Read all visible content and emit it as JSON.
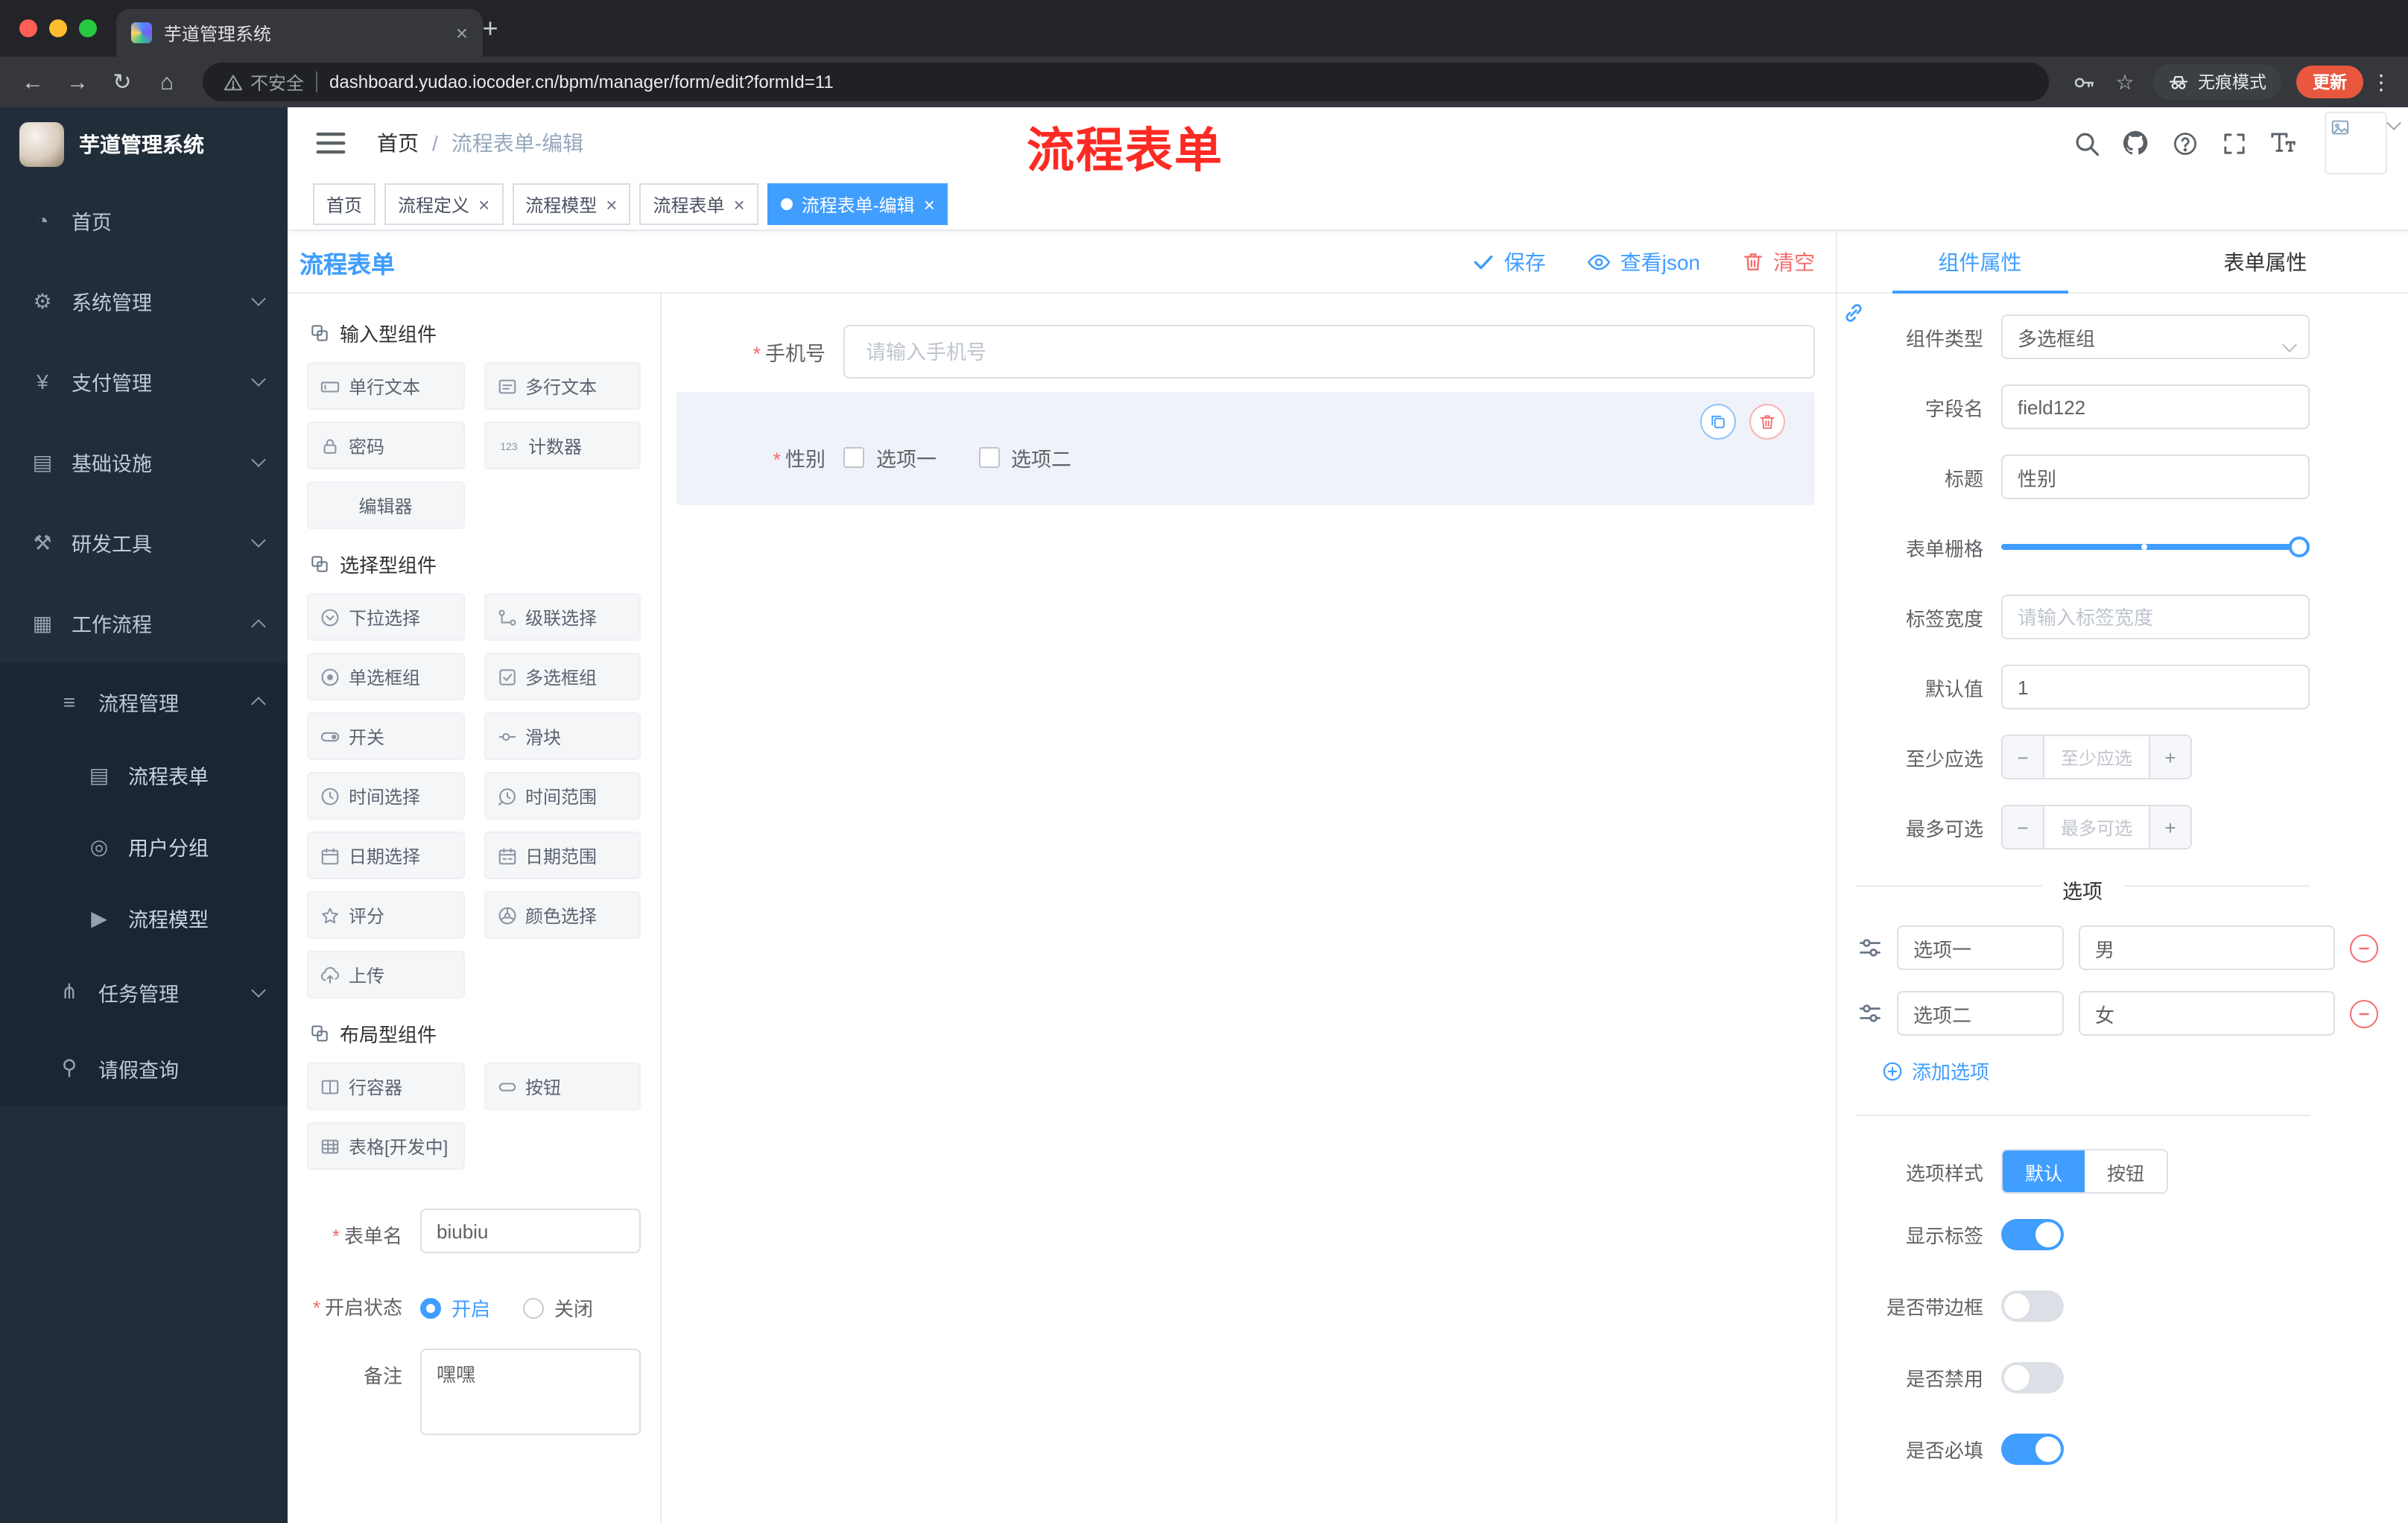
{
  "icons": {
    "close": "×",
    "plus": "+",
    "more": "⋮",
    "back": "←",
    "forward": "→",
    "reload": "↻",
    "home": "⌂",
    "bookmark": "☆",
    "required": "*",
    "minus": "−"
  },
  "browser": {
    "tab_title": "芋道管理系统",
    "security_label": "不安全",
    "url": "dashboard.yudao.iocoder.cn/bpm/manager/form/edit?formId=11",
    "incognito_label": "无痕模式",
    "update_label": "更新"
  },
  "sidebar": {
    "logo_text": "芋道管理系统",
    "items": [
      {
        "label": "首页",
        "glyph": "◔"
      },
      {
        "label": "系统管理",
        "glyph": "⚙"
      },
      {
        "label": "支付管理",
        "glyph": "¥"
      },
      {
        "label": "基础设施",
        "glyph": "▤"
      },
      {
        "label": "研发工具",
        "glyph": "⚒"
      },
      {
        "label": "工作流程",
        "glyph": "▦"
      },
      {
        "label": "流程管理",
        "glyph": "≡"
      },
      {
        "label": "流程表单",
        "glyph": "▤"
      },
      {
        "label": "用户分组",
        "glyph": "◎"
      },
      {
        "label": "流程模型",
        "glyph": "▶"
      },
      {
        "label": "任务管理",
        "glyph": "⋔"
      },
      {
        "label": "请假查询",
        "glyph": "⚲"
      }
    ]
  },
  "header": {
    "breadcrumb_home": "首页",
    "breadcrumb_sep": "/",
    "breadcrumb_current": "流程表单-编辑",
    "annotation": "流程表单"
  },
  "tags": [
    {
      "label": "首页"
    },
    {
      "label": "流程定义"
    },
    {
      "label": "流程模型"
    },
    {
      "label": "流程表单"
    },
    {
      "label": "流程表单-编辑"
    }
  ],
  "designer": {
    "title": "流程表单",
    "save": "保存",
    "view_json": "查看json",
    "clear": "清空",
    "groups": [
      {
        "title": "输入型组件",
        "items": [
          {
            "label": "单行文本"
          },
          {
            "label": "多行文本"
          },
          {
            "label": "密码"
          },
          {
            "label": "计数器"
          },
          {
            "label": "编辑器"
          }
        ]
      },
      {
        "title": "选择型组件",
        "items": [
          {
            "label": "下拉选择"
          },
          {
            "label": "级联选择"
          },
          {
            "label": "单选框组"
          },
          {
            "label": "多选框组"
          },
          {
            "label": "开关"
          },
          {
            "label": "滑块"
          },
          {
            "label": "时间选择"
          },
          {
            "label": "时间范围"
          },
          {
            "label": "日期选择"
          },
          {
            "label": "日期范围"
          },
          {
            "label": "评分"
          },
          {
            "label": "颜色选择"
          },
          {
            "label": "上传"
          }
        ]
      },
      {
        "title": "布局型组件",
        "items": [
          {
            "label": "行容器"
          },
          {
            "label": "按钮"
          },
          {
            "label": "表格[开发中]"
          }
        ]
      }
    ],
    "meta": {
      "form_name_label": "表单名",
      "form_name_value": "biubiu",
      "status_label": "开启状态",
      "status_on": "开启",
      "status_off": "关闭",
      "remark_label": "备注",
      "remark_value": "嘿嘿"
    },
    "canvas": {
      "phone_label": "手机号",
      "phone_placeholder": "请输入手机号",
      "gender_label": "性别",
      "gender_options": [
        "选项一",
        "选项二"
      ]
    }
  },
  "properties": {
    "tabs": {
      "component": "组件属性",
      "form": "表单属性"
    },
    "rows": {
      "type": {
        "label": "组件类型",
        "value": "多选框组"
      },
      "field": {
        "label": "字段名",
        "value": "field122"
      },
      "title": {
        "label": "标题",
        "value": "性别"
      },
      "grid": {
        "label": "表单栅格"
      },
      "label_width": {
        "label": "标签宽度",
        "placeholder": "请输入标签宽度"
      },
      "default": {
        "label": "默认值",
        "value": "1"
      },
      "min": {
        "label": "至少应选",
        "placeholder": "至少应选"
      },
      "max": {
        "label": "最多可选",
        "placeholder": "最多可选"
      },
      "style": {
        "label": "选项样式",
        "default": "默认",
        "button": "按钮"
      }
    },
    "options": {
      "title": "选项",
      "rows": [
        {
          "name": "选项一",
          "value": "男"
        },
        {
          "name": "选项二",
          "value": "女"
        }
      ],
      "add": "添加选项"
    },
    "switches": {
      "show": {
        "label": "显示标签",
        "on": true
      },
      "border": {
        "label": "是否带边框",
        "on": false
      },
      "disabled": {
        "label": "是否禁用",
        "on": false
      },
      "required": {
        "label": "是否必填",
        "on": true
      }
    }
  },
  "colors": {
    "accent": "#409EFF",
    "danger": "#F56C6C",
    "sidebar": "#222d3a"
  }
}
